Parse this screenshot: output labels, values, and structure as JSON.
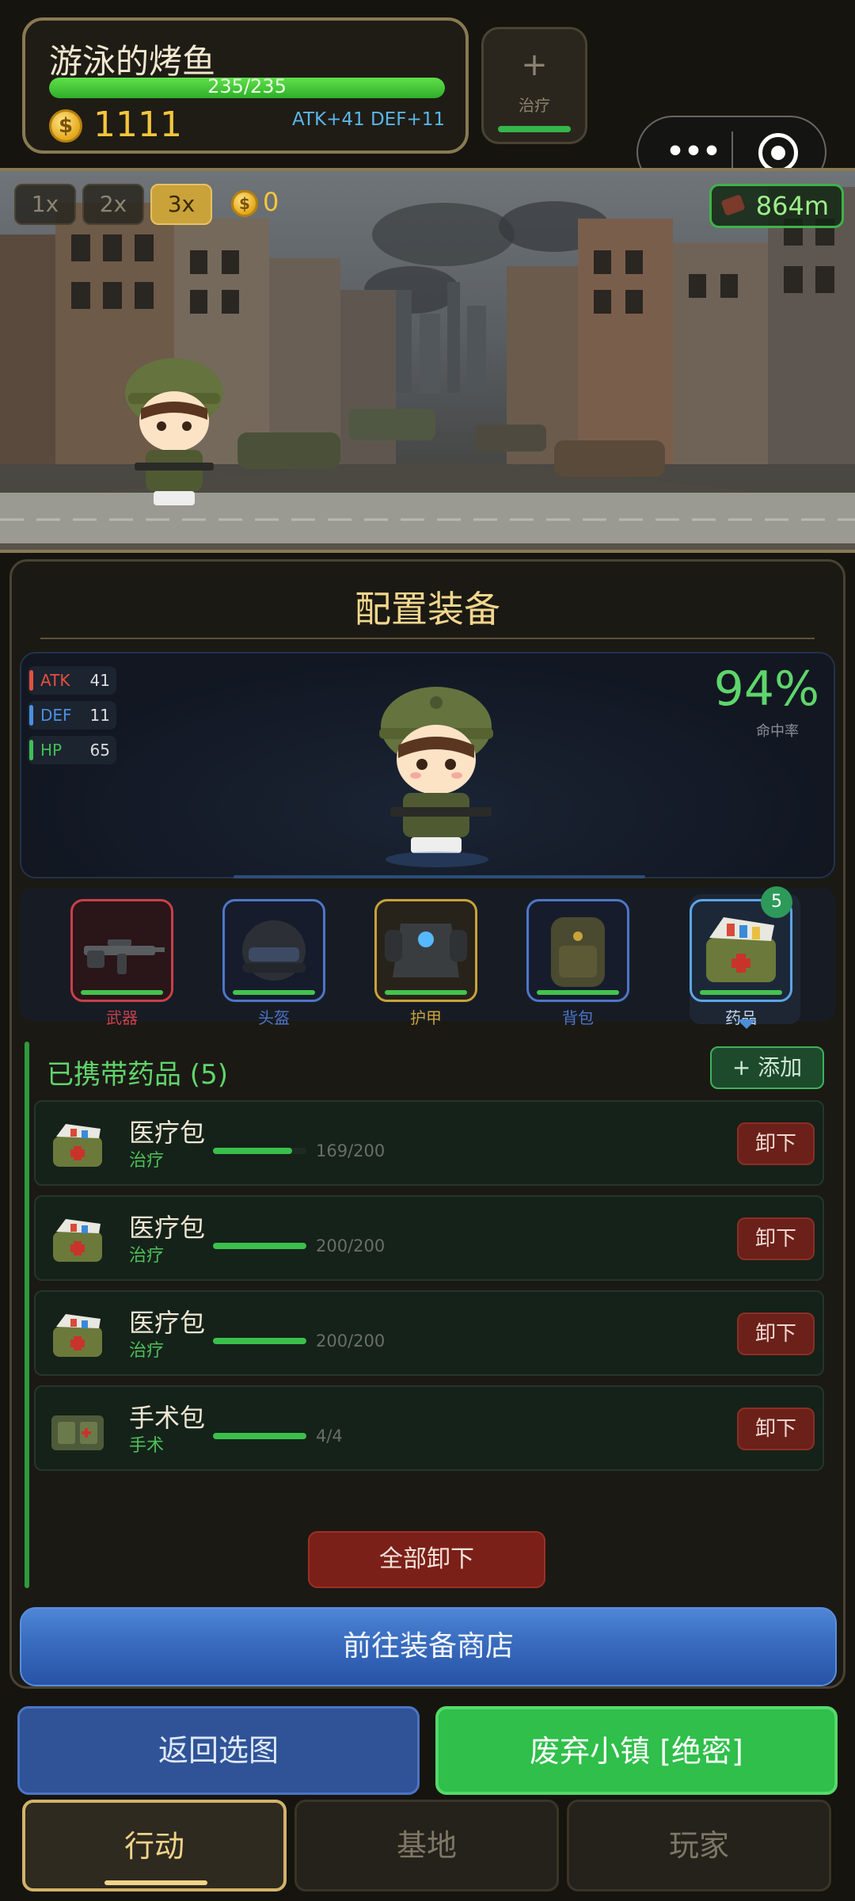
{
  "player": {
    "name": "游泳的烤鱼",
    "hp_text": "235/235",
    "hp_fraction": 1.0,
    "gold": "1111",
    "bonus": "ATK+41 DEF+11"
  },
  "heal": {
    "icon": "+",
    "label": "治疗"
  },
  "capsule": {
    "dots": "•••"
  },
  "scene": {
    "speeds": [
      "1x",
      "2x",
      "3x"
    ],
    "active_speed": "3x",
    "coins": "0",
    "distance": "864m"
  },
  "panel": {
    "title": "配置装备",
    "stats": [
      {
        "label": "ATK",
        "value": "41",
        "color": "#e0513f"
      },
      {
        "label": "DEF",
        "value": "11",
        "color": "#4b8fe0"
      },
      {
        "label": "HP",
        "value": "65",
        "color": "#3fbf55"
      }
    ],
    "hit_rate": "94%",
    "hit_label": "命中率"
  },
  "slots": [
    {
      "label": "武器",
      "color": "#c8404b",
      "bg": "#2a1518",
      "icon": "rifle-icon"
    },
    {
      "label": "头盔",
      "color": "#4d76c8",
      "bg": "#161c2c",
      "icon": "helmet-icon"
    },
    {
      "label": "护甲",
      "color": "#c9a23a",
      "bg": "#27231a",
      "icon": "armor-icon"
    },
    {
      "label": "背包",
      "color": "#4d76c8",
      "bg": "#161c2c",
      "icon": "backpack-icon"
    },
    {
      "label": "药品",
      "color": "#5aa6ea",
      "bg": "#1c2838",
      "icon": "medkit-icon",
      "badge": "5"
    }
  ],
  "meds": {
    "title": "已携带药品 (5)",
    "add_label": "+ 添加",
    "items": [
      {
        "name": "医疗包",
        "type": "治疗",
        "count": "169/200",
        "fraction": 0.845,
        "action": "卸下"
      },
      {
        "name": "医疗包",
        "type": "治疗",
        "count": "200/200",
        "fraction": 1.0,
        "action": "卸下"
      },
      {
        "name": "医疗包",
        "type": "治疗",
        "count": "200/200",
        "fraction": 1.0,
        "action": "卸下"
      },
      {
        "name": "手术包",
        "type": "手术",
        "count": "4/4",
        "fraction": 1.0,
        "action": "卸下"
      }
    ],
    "unequip_all": "全部卸下"
  },
  "shop_button": "前往装备商店",
  "bottom": {
    "back": "返回选图",
    "go": "废弃小镇 [绝密]",
    "tabs": [
      "行动",
      "基地",
      "玩家"
    ],
    "active_tab": "行动"
  }
}
